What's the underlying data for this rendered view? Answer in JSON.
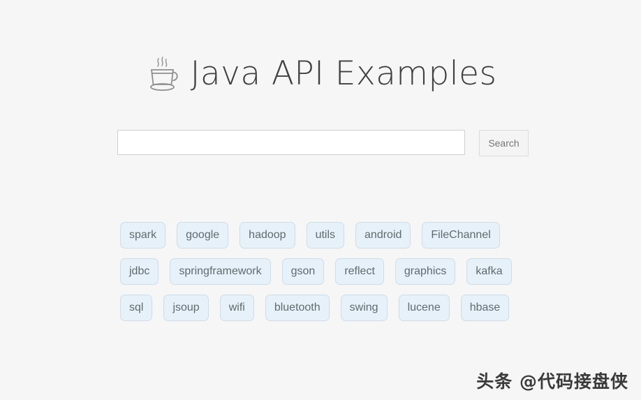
{
  "page": {
    "background_color": "#f6f6f6"
  },
  "header": {
    "icon": "coffee-cup-icon",
    "title": "Java API Examples",
    "title_color": "#3f3f3f"
  },
  "search": {
    "value": "",
    "placeholder": "",
    "button_label": "Search"
  },
  "tag_cloud": {
    "tag_background_color": "#e7f1f9",
    "tag_border_color": "#cfdce6",
    "tag_text_color": "#5f6b70",
    "rows": [
      {
        "tags": [
          {
            "label": "spark"
          },
          {
            "label": "google"
          },
          {
            "label": "hadoop"
          },
          {
            "label": "utils"
          },
          {
            "label": "android"
          },
          {
            "label": "FileChannel"
          }
        ]
      },
      {
        "tags": [
          {
            "label": "jdbc"
          },
          {
            "label": "springframework"
          },
          {
            "label": "gson"
          },
          {
            "label": "reflect"
          },
          {
            "label": "graphics"
          },
          {
            "label": "kafka"
          }
        ]
      },
      {
        "tags": [
          {
            "label": "sql"
          },
          {
            "label": "jsoup"
          },
          {
            "label": "wifi"
          },
          {
            "label": "bluetooth"
          },
          {
            "label": "swing"
          },
          {
            "label": "lucene"
          },
          {
            "label": "hbase"
          }
        ]
      }
    ]
  },
  "watermark": {
    "text": "头条 @代码接盘侠"
  }
}
